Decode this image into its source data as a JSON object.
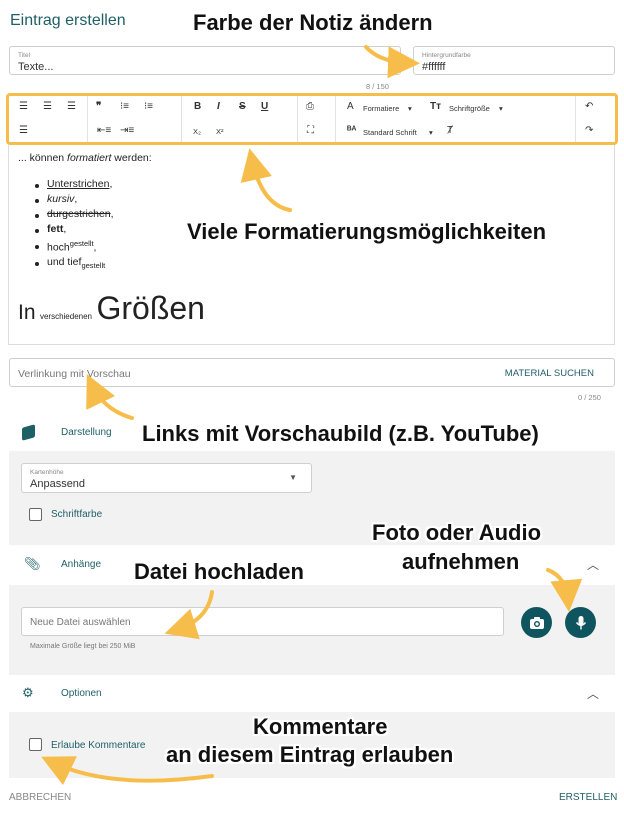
{
  "header": {
    "title": "Eintrag erstellen"
  },
  "title_field": {
    "label": "Titel",
    "value": "Texte...",
    "counter": "8 / 150"
  },
  "bg_field": {
    "label": "Hintergrundfarbe",
    "value": "#ffffff"
  },
  "toolbar": {
    "format_label": "Formatiere",
    "fontsize_label": "Schriftgröße",
    "font_label": "Standard Schrift",
    "bold": "B",
    "italic": "I",
    "strike": "S",
    "underline": "U",
    "subscript": "X₂",
    "superscript": "X²"
  },
  "editor": {
    "intro_pre": "... können ",
    "intro_em": "formatiert",
    "intro_post": " werden:",
    "items": {
      "underline": "Unterstrichen",
      "italic": "kursiv",
      "strike": "durgestrichen",
      "bold": "fett",
      "sup_base": "hoch",
      "sup_text": "gestellt",
      "sub_base": "und tief",
      "sub_text": "gestellt",
      "comma": ","
    },
    "sizes": {
      "small1": "In",
      "small2": "verschiedenen",
      "large": "Größen"
    }
  },
  "link_field": {
    "placeholder": "Verlinkung mit Vorschau",
    "action": "MATERIAL SUCHEN",
    "counter": "0 / 250"
  },
  "darstellung": {
    "heading": "Darstellung",
    "select_label": "Kartenhöhe",
    "select_value": "Anpassend",
    "font_color_label": "Schriftfarbe"
  },
  "anhaenge": {
    "heading": "Anhänge",
    "file_placeholder": "Neue Datei auswählen",
    "hint": "Maximale Größe liegt bei 250 MiB"
  },
  "optionen": {
    "heading": "Optionen",
    "allow_comments_label": "Erlaube Kommentare"
  },
  "footer": {
    "cancel": "ABBRECHEN",
    "create": "ERSTELLEN"
  },
  "callouts": {
    "color": "Farbe der Notiz ändern",
    "format": "Viele Formatierungsmöglichkeiten",
    "links": "Links mit Vorschaubild (z.B. YouTube)",
    "media_line1": "Foto oder Audio",
    "media_line2": "aufnehmen",
    "upload": "Datei hochladen",
    "comments_line1": "Kommentare",
    "comments_line2": "an diesem Eintrag erlauben"
  },
  "colors": {
    "accent": "#1f5f66",
    "button": "#0f5560",
    "highlight": "#f6bd4a",
    "panel": "#f2f2f2"
  }
}
